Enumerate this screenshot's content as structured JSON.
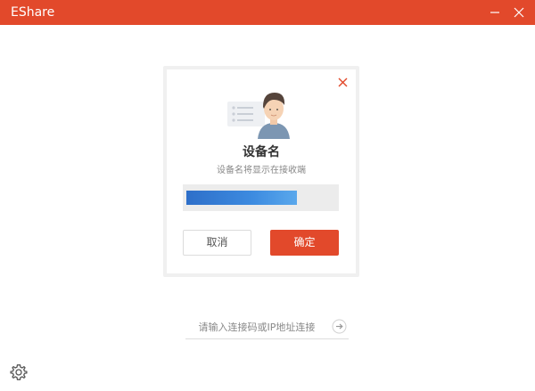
{
  "window": {
    "title": "EShare",
    "accent_color": "#e2492b",
    "controls": [
      "minimize-icon",
      "close-icon"
    ]
  },
  "dialog": {
    "title": "设备名",
    "subtitle": "设备名将显示在接收端",
    "device_name_value": "",
    "close_icon": "close-icon",
    "illustration_icon": "user-device-illustration",
    "cancel_label": "取消",
    "confirm_label": "确定"
  },
  "connect": {
    "placeholder": "请输入连接码或IP地址连接",
    "go_icon": "arrow-right-circle-icon"
  },
  "footer": {
    "settings_icon": "gear-icon"
  }
}
